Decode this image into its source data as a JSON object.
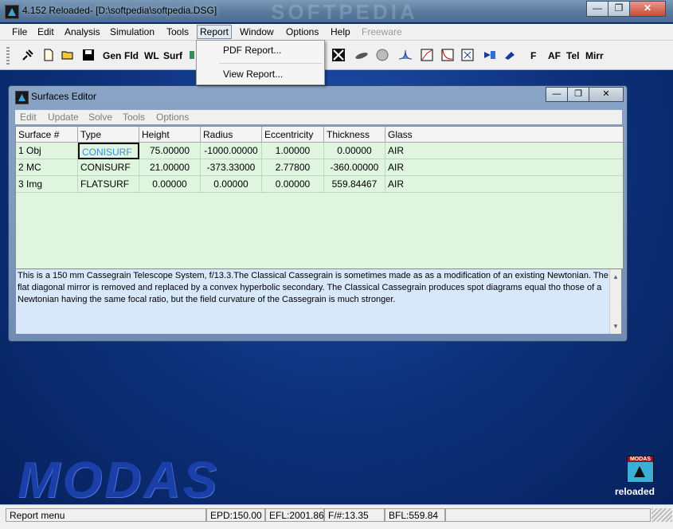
{
  "window": {
    "title": "4.152 Reloaded- [D:\\softpedia\\softpedia.DSG]",
    "watermark": "SOFTPEDIA",
    "minimize": "—",
    "restore": "❐",
    "close": "✕"
  },
  "menubar": [
    {
      "label": "File"
    },
    {
      "label": "Edit"
    },
    {
      "label": "Analysis"
    },
    {
      "label": "Simulation"
    },
    {
      "label": "Tools"
    },
    {
      "label": "Report"
    },
    {
      "label": "Window"
    },
    {
      "label": "Options"
    },
    {
      "label": "Help"
    },
    {
      "label": "Freeware"
    }
  ],
  "toolbar": {
    "gen": "Gen",
    "fld": "Fld",
    "wl": "WL",
    "surf": "Surf",
    "f": "F",
    "af": "AF",
    "tel": "Tel",
    "mirr": "Mirr"
  },
  "report_menu": {
    "pdf": "PDF Report...",
    "view": "View Report..."
  },
  "editor": {
    "title": "Surfaces Editor",
    "menu": [
      "Edit",
      "Update",
      "Solve",
      "Tools",
      "Options"
    ],
    "columns": [
      "Surface #",
      "Type",
      "Height",
      "Radius",
      "Eccentricity",
      "Thickness",
      "Glass"
    ],
    "rows": [
      [
        "1 Obj",
        "CONISURF",
        "75.00000",
        "-1000.00000",
        "1.00000",
        "0.00000",
        "AIR"
      ],
      [
        "2 MC",
        "CONISURF",
        "21.00000",
        "-373.33000",
        "2.77800",
        "-360.00000",
        "AIR"
      ],
      [
        "3 Img",
        "FLATSURF",
        "0.00000",
        "0.00000",
        "0.00000",
        "559.84467",
        "AIR"
      ]
    ],
    "notes": "This is a 150 mm Cassegrain Telescope System, f/13.3.The Classical Cassegrain is sometimes made as as a modification of an existing Newtonian. The flat diagonal mirror is removed and replaced by a convex hyperbolic secondary. The Classical Cassegrain produces spot diagrams equal tho those of a Newtonian having the same focal ratio, but the field curvature of the Cassegrain is much stronger."
  },
  "branding": {
    "modas": "MODAS",
    "reloaded": "reloaded"
  },
  "statusbar": {
    "message": "Report menu",
    "epd": "EPD:150.00",
    "efl": "EFL:2001.86",
    "fnum": "F/#:13.35",
    "bfl": "BFL:559.84"
  },
  "colors": {
    "grid_bg": "#dff5df",
    "notes_bg": "#d8e8fb",
    "selected_text": "#3a8ed8"
  }
}
